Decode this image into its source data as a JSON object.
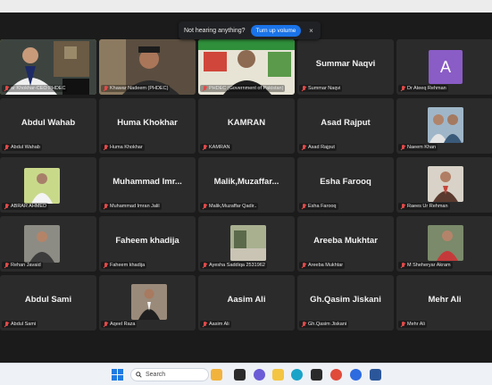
{
  "banner": {
    "message": "Not hearing anything?",
    "button": "Turn up volume",
    "close": "×"
  },
  "participants": [
    {
      "display": "",
      "label": "ar Khokhar-CEO PHDEC",
      "kind": "video1"
    },
    {
      "display": "",
      "label": "Khawar Nadeem (PHDEC)",
      "kind": "video2"
    },
    {
      "display": "",
      "label": "PHDEC (Government of Pakistan)",
      "kind": "video3"
    },
    {
      "display": "Summar Naqvi",
      "label": "Summar Naqvi",
      "kind": "name"
    },
    {
      "display": "A",
      "label": "Dr Ateeq Rehman",
      "kind": "avatar"
    },
    {
      "display": "Abdul Wahab",
      "label": "Abdul Wahab",
      "kind": "name"
    },
    {
      "display": "Huma Khokhar",
      "label": "Huma Khokhar",
      "kind": "name"
    },
    {
      "display": "KAMRAN",
      "label": "KAMRAN",
      "kind": "name"
    },
    {
      "display": "Asad Rajput",
      "label": "Asad Rajput",
      "kind": "name"
    },
    {
      "display": "",
      "label": "Naeem Khan",
      "kind": "photo-pair"
    },
    {
      "display": "",
      "label": "ABRAR AHMED",
      "kind": "photo-white"
    },
    {
      "display": "Muhammad  Imr...",
      "label": "Muhammad Imran Jalil",
      "kind": "name"
    },
    {
      "display": "Malik,Muzaffar...",
      "label": "Malik,Muzaffar Qadir..",
      "kind": "name"
    },
    {
      "display": "Esha Farooq",
      "label": "Esha Farooq",
      "kind": "name"
    },
    {
      "display": "",
      "label": "Raees Ur Rehman",
      "kind": "photo-suit"
    },
    {
      "display": "",
      "label": "Rehan Javaid",
      "kind": "photo-man"
    },
    {
      "display": "Faheem khadija",
      "label": "Faheem khadija",
      "kind": "name"
    },
    {
      "display": "",
      "label": "Ayesha Saddiqa 2531962",
      "kind": "photo-outdoor"
    },
    {
      "display": "Areeba Mukhtar",
      "label": "Areeba Mukhtar",
      "kind": "name"
    },
    {
      "display": "",
      "label": "M Sheheryar Akram",
      "kind": "photo-red"
    },
    {
      "display": "Abdul Sami",
      "label": "Abdul Sami",
      "kind": "name"
    },
    {
      "display": "",
      "label": "Aqeel Raza",
      "kind": "photo-formal"
    },
    {
      "display": "Aasim Ali",
      "label": "Aasim Ali",
      "kind": "name"
    },
    {
      "display": "Gh.Qasim Jiskani",
      "label": "Gh.Qasim Jiskani",
      "kind": "name"
    },
    {
      "display": "Mehr Ali",
      "label": "Mehr Ali",
      "kind": "name"
    }
  ],
  "taskbar": {
    "search_placeholder": "Search"
  }
}
